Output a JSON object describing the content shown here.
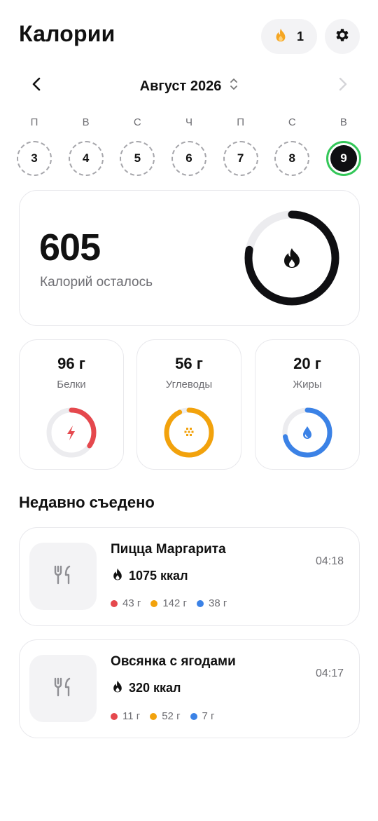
{
  "header": {
    "title": "Калории",
    "streak_count": "1"
  },
  "calendar": {
    "month": "Август 2026",
    "weekdays": [
      "П",
      "В",
      "С",
      "Ч",
      "П",
      "С",
      "В"
    ],
    "days": [
      "3",
      "4",
      "5",
      "6",
      "7",
      "8",
      "9"
    ],
    "selected_day": "9"
  },
  "calories": {
    "remaining": "605",
    "label": "Калорий осталось",
    "ring_progress": 0.78
  },
  "macros": [
    {
      "value": "96 г",
      "label": "Белки",
      "color": "#e5484d",
      "progress": 0.35,
      "icon": "lightning-icon"
    },
    {
      "value": "56 г",
      "label": "Углеводы",
      "color": "#f2a20c",
      "progress": 0.93,
      "icon": "grain-icon"
    },
    {
      "value": "20 г",
      "label": "Жиры",
      "color": "#3b82e6",
      "progress": 0.72,
      "icon": "drop-icon"
    }
  ],
  "recent": {
    "title": "Недавно съедено",
    "items": [
      {
        "name": "Пицца Маргарита",
        "kcal": "1075 ккал",
        "time": "04:18",
        "protein": "43 г",
        "carbs": "142 г",
        "fat": "38 г"
      },
      {
        "name": "Овсянка с ягодами",
        "kcal": "320 ккал",
        "time": "04:17",
        "protein": "11 г",
        "carbs": "52 г",
        "fat": "7 г"
      }
    ]
  },
  "colors": {
    "protein": "#e5484d",
    "carbs": "#f2a20c",
    "fat": "#3b82e6",
    "streak_flame": "#f5a623",
    "selected_ring": "#34c759"
  }
}
